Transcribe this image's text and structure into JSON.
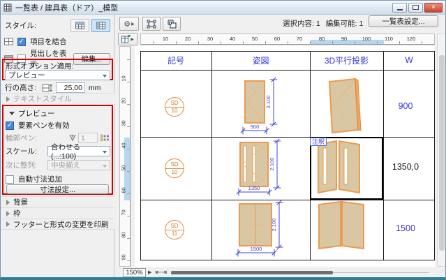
{
  "window": {
    "title": "一覧表 / 建具表（ドア）_模型",
    "selection_info": "選択内容: 1",
    "editable_info": "編集可能: 1",
    "schedule_settings_button": "一覧表設定...",
    "zoom_level": "150%"
  },
  "sidebar": {
    "style_label": "スタイル:",
    "merge_items_label": "項目を結合",
    "show_headings_label": "見出しを表示",
    "edit_button": "編集...",
    "format_options_label": "形式オプション適用:",
    "format_options_value": "プレビュー",
    "row_height_label": "行の高さ:",
    "row_height_value": "25,00",
    "row_height_unit": "mm",
    "text_style_section": "テキストスタイル",
    "preview_section": "プレビュー",
    "element_pen_label": "要素ペンを有効",
    "outline_pen_label": "輪郭ペン:",
    "outline_pen_value": "1",
    "scale_label": "スケール:",
    "scale_value": "合わせる (...:100)",
    "align_label": "次に整列:",
    "align_value": "中央揃え",
    "auto_dimension_label": "自動寸法追加",
    "dimension_settings_button": "寸法設定...",
    "background_section": "背景",
    "frame_section": "枠",
    "footer_section": "フッターと形式の変更を印刷"
  },
  "rulers": {
    "horizontal": [
      "10",
      "20",
      "30",
      "40",
      "50",
      "60",
      "70",
      "80",
      "90",
      "100",
      "110",
      "120"
    ],
    "vertical": [
      "10",
      "20",
      "30",
      "40",
      "50",
      "60",
      "70",
      "80",
      "90"
    ]
  },
  "schedule": {
    "headers": [
      "記号",
      "姿図",
      "3D平行投影",
      "W"
    ],
    "rows": [
      {
        "symbol_type": "SD",
        "symbol_number": "10",
        "height_dim": "2.100",
        "width_dim": "900",
        "w_value": "900"
      },
      {
        "symbol_type": "SD",
        "symbol_number": "10",
        "height_dim": "2.100",
        "width_dim": "1350",
        "w_value": "1350,0",
        "annotation": "注釈"
      },
      {
        "symbol_type": "SD",
        "symbol_number": "11",
        "height_dim": "2.100",
        "width_dim": "1500",
        "w_value": "1500"
      }
    ]
  },
  "colors": {
    "door_stroke": "#ec9a50",
    "door_fill": "#d9c7a4",
    "dimension_blue": "#4343d8",
    "header_blue": "#3434d6",
    "annotation_box_red": "#d20000",
    "ruler_highlight": "#b8d7ee"
  }
}
